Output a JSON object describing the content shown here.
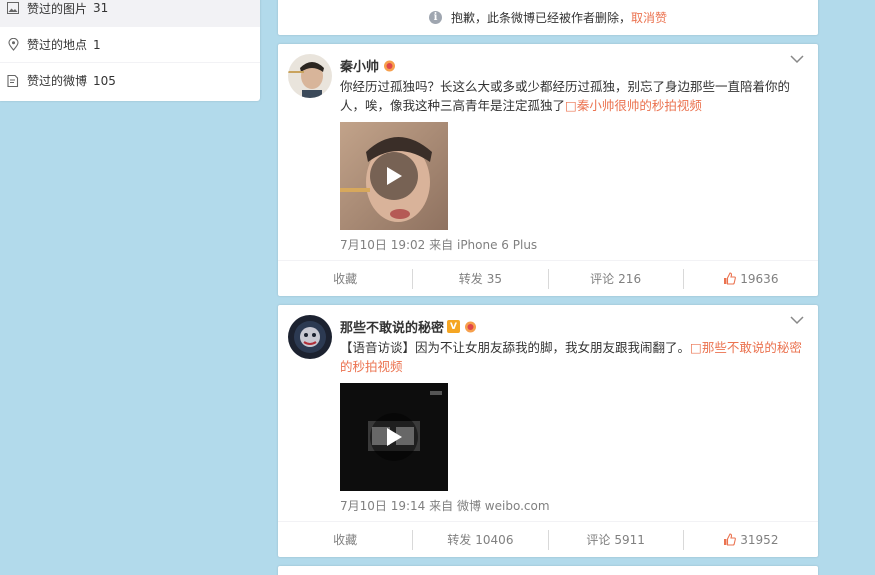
{
  "sidebar": {
    "items": [
      {
        "label": "赞过的图片",
        "count": "31",
        "icon": "image-icon"
      },
      {
        "label": "赞过的地点",
        "count": "1",
        "icon": "location-icon"
      },
      {
        "label": "赞过的微博",
        "count": "105",
        "icon": "weibo-post-icon"
      }
    ]
  },
  "deleted_notice": {
    "text": "抱歉，此条微博已经被作者删除，",
    "cancel": "取消赞"
  },
  "posts": [
    {
      "author": "秦小帅",
      "text": "你经历过孤独吗？长这么大或多或少都经历过孤独，别忘了身边那些一直陪着你的人，唉，像我这种三高青年是注定孤独了",
      "link": "□秦小帅很帅的秒拍视频",
      "time": "7月10日 19:02",
      "source_prefix": "来自",
      "source": "iPhone 6 Plus",
      "actions": {
        "favorite": "收藏",
        "repost": "转发",
        "repost_count": "35",
        "comment": "评论",
        "comment_count": "216",
        "like_count": "19636"
      }
    },
    {
      "author": "那些不敢说的秘密",
      "text": "【语音访谈】因为不让女朋友舔我的脚，我女朋友跟我闹翻了。",
      "link": "□那些不敢说的秘密的秒拍视频",
      "time": "7月10日 19:14",
      "source_prefix": "来自",
      "source": "微博 weibo.com",
      "actions": {
        "favorite": "收藏",
        "repost": "转发",
        "repost_count": "10406",
        "comment": "评论",
        "comment_count": "5911",
        "like_count": "31952"
      }
    }
  ],
  "colors": {
    "background": "#b2daeb",
    "link": "#eb7350",
    "muted": "#808080"
  }
}
